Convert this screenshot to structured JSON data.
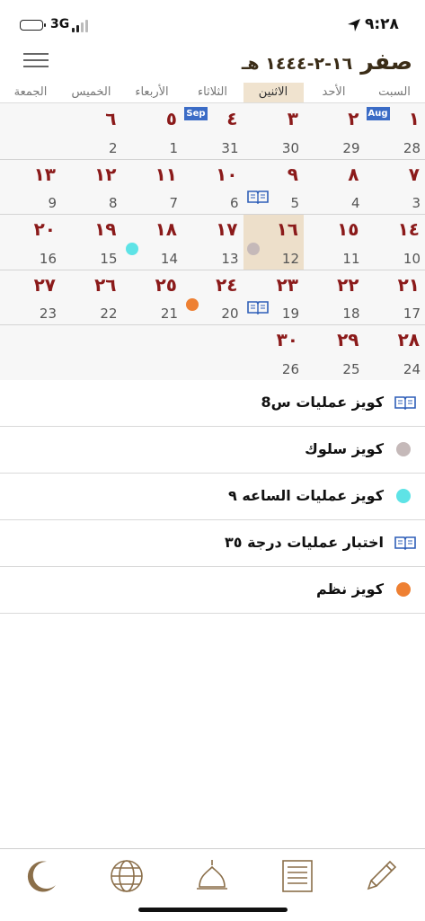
{
  "status_bar": {
    "time": "٩:٢٨",
    "network": "3G"
  },
  "header": {
    "month": "صفر",
    "date": "١٦-٢-١٤٤٤ هـ"
  },
  "weekdays": [
    {
      "label": "السبت",
      "active": false
    },
    {
      "label": "الأحد",
      "active": false
    },
    {
      "label": "الاثنين",
      "active": true
    },
    {
      "label": "الثلاثاء",
      "active": false
    },
    {
      "label": "الأربعاء",
      "active": false
    },
    {
      "label": "الخميس",
      "active": false
    },
    {
      "label": "الجمعة",
      "active": false
    }
  ],
  "calendar": {
    "weeks": [
      [
        {
          "hijri": "١",
          "greg": "28",
          "badge": "Aug"
        },
        {
          "hijri": "٢",
          "greg": "29"
        },
        {
          "hijri": "٣",
          "greg": "30"
        },
        {
          "hijri": "٤",
          "greg": "31",
          "badge": "Sep"
        },
        {
          "hijri": "٥",
          "greg": "1"
        },
        {
          "hijri": "٦",
          "greg": "2"
        },
        {
          "hijri": "",
          "greg": ""
        }
      ],
      [
        {
          "hijri": "٧",
          "greg": "3"
        },
        {
          "hijri": "٨",
          "greg": "4"
        },
        {
          "hijri": "٩",
          "greg": "5",
          "marker": "book",
          "marker_color": "#2f5fb8"
        },
        {
          "hijri": "١٠",
          "greg": "6"
        },
        {
          "hijri": "١١",
          "greg": "7"
        },
        {
          "hijri": "١٢",
          "greg": "8"
        },
        {
          "hijri": "١٣",
          "greg": "9"
        }
      ],
      [
        {
          "hijri": "١٤",
          "greg": "10"
        },
        {
          "hijri": "١٥",
          "greg": "11"
        },
        {
          "hijri": "١٦",
          "greg": "12",
          "today": true,
          "marker": "dot",
          "marker_color": "#c5b9b9"
        },
        {
          "hijri": "١٧",
          "greg": "13"
        },
        {
          "hijri": "١٨",
          "greg": "14",
          "marker": "dot",
          "marker_color": "#5ee3e6"
        },
        {
          "hijri": "١٩",
          "greg": "15"
        },
        {
          "hijri": "٢٠",
          "greg": "16"
        }
      ],
      [
        {
          "hijri": "٢١",
          "greg": "17"
        },
        {
          "hijri": "٢٢",
          "greg": "18"
        },
        {
          "hijri": "٢٣",
          "greg": "19",
          "marker": "book",
          "marker_color": "#2f5fb8"
        },
        {
          "hijri": "٢٤",
          "greg": "20",
          "marker": "dot",
          "marker_color": "#ee8033"
        },
        {
          "hijri": "٢٥",
          "greg": "21"
        },
        {
          "hijri": "٢٦",
          "greg": "22"
        },
        {
          "hijri": "٢٧",
          "greg": "23"
        }
      ],
      [
        {
          "hijri": "٢٨",
          "greg": "24"
        },
        {
          "hijri": "٢٩",
          "greg": "25"
        },
        {
          "hijri": "٣٠",
          "greg": "26"
        },
        {
          "hijri": "",
          "greg": ""
        },
        {
          "hijri": "",
          "greg": ""
        },
        {
          "hijri": "",
          "greg": ""
        },
        {
          "hijri": "",
          "greg": ""
        }
      ]
    ]
  },
  "events": [
    {
      "title": "كويز عمليات س8",
      "marker": "book",
      "color": "#2f5fb8"
    },
    {
      "title": "كويز سلوك",
      "marker": "dot",
      "color": "#c5b9b9"
    },
    {
      "title": "كويز عمليات الساعه ٩",
      "marker": "dot",
      "color": "#5ee3e6"
    },
    {
      "title": "اختبار عمليات درجة ٣٥",
      "marker": "book",
      "color": "#2f5fb8"
    },
    {
      "title": "كويز نظم",
      "marker": "dot",
      "color": "#ee8033"
    }
  ],
  "tab_bar": {
    "tabs": [
      {
        "icon": "crescent-icon"
      },
      {
        "icon": "globe-icon"
      },
      {
        "icon": "mosque-dome-icon"
      },
      {
        "icon": "notes-list-icon"
      },
      {
        "icon": "pencil-icon"
      }
    ]
  },
  "colors": {
    "accent_brown": "#8b6f4a",
    "hijri_red": "#8b1a1a",
    "today_bg": "#eddfca",
    "month_badge": "#3b6cc6"
  }
}
